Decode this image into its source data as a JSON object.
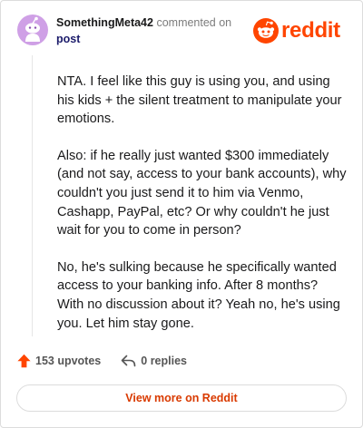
{
  "comment": {
    "author": "SomethingMeta42",
    "action": "commented on",
    "target": "post",
    "paragraphs": [
      "NTA. I feel like this guy is using you, and using his kids + the silent treatment to manipulate your emotions.",
      "Also: if he really just wanted $300 immediately (and not say, access to your bank accounts), why couldn't you just send it to him via Venmo, Cashapp, PayPal, etc? Or why couldn't he just wait for you to come in person?",
      "No, he's sulking because he specifically wanted access to your banking info. After 8 months? With no discussion about it? Yeah no, he's using you. Let him stay gone."
    ]
  },
  "brand": {
    "wordmark": "reddit",
    "color": "#ff4500"
  },
  "stats": {
    "upvotes": "153 upvotes",
    "replies": "0 replies"
  },
  "footer": {
    "view_more": "View more on Reddit"
  },
  "colors": {
    "accent": "#ff4500",
    "link": "#d93a00",
    "avatar_bg": "#cfa0e6"
  },
  "icons": {
    "avatar": "snoo-avatar-icon",
    "logo": "reddit-snoo-icon",
    "upvote": "upvote-arrow-icon",
    "reply": "reply-arrow-icon"
  }
}
